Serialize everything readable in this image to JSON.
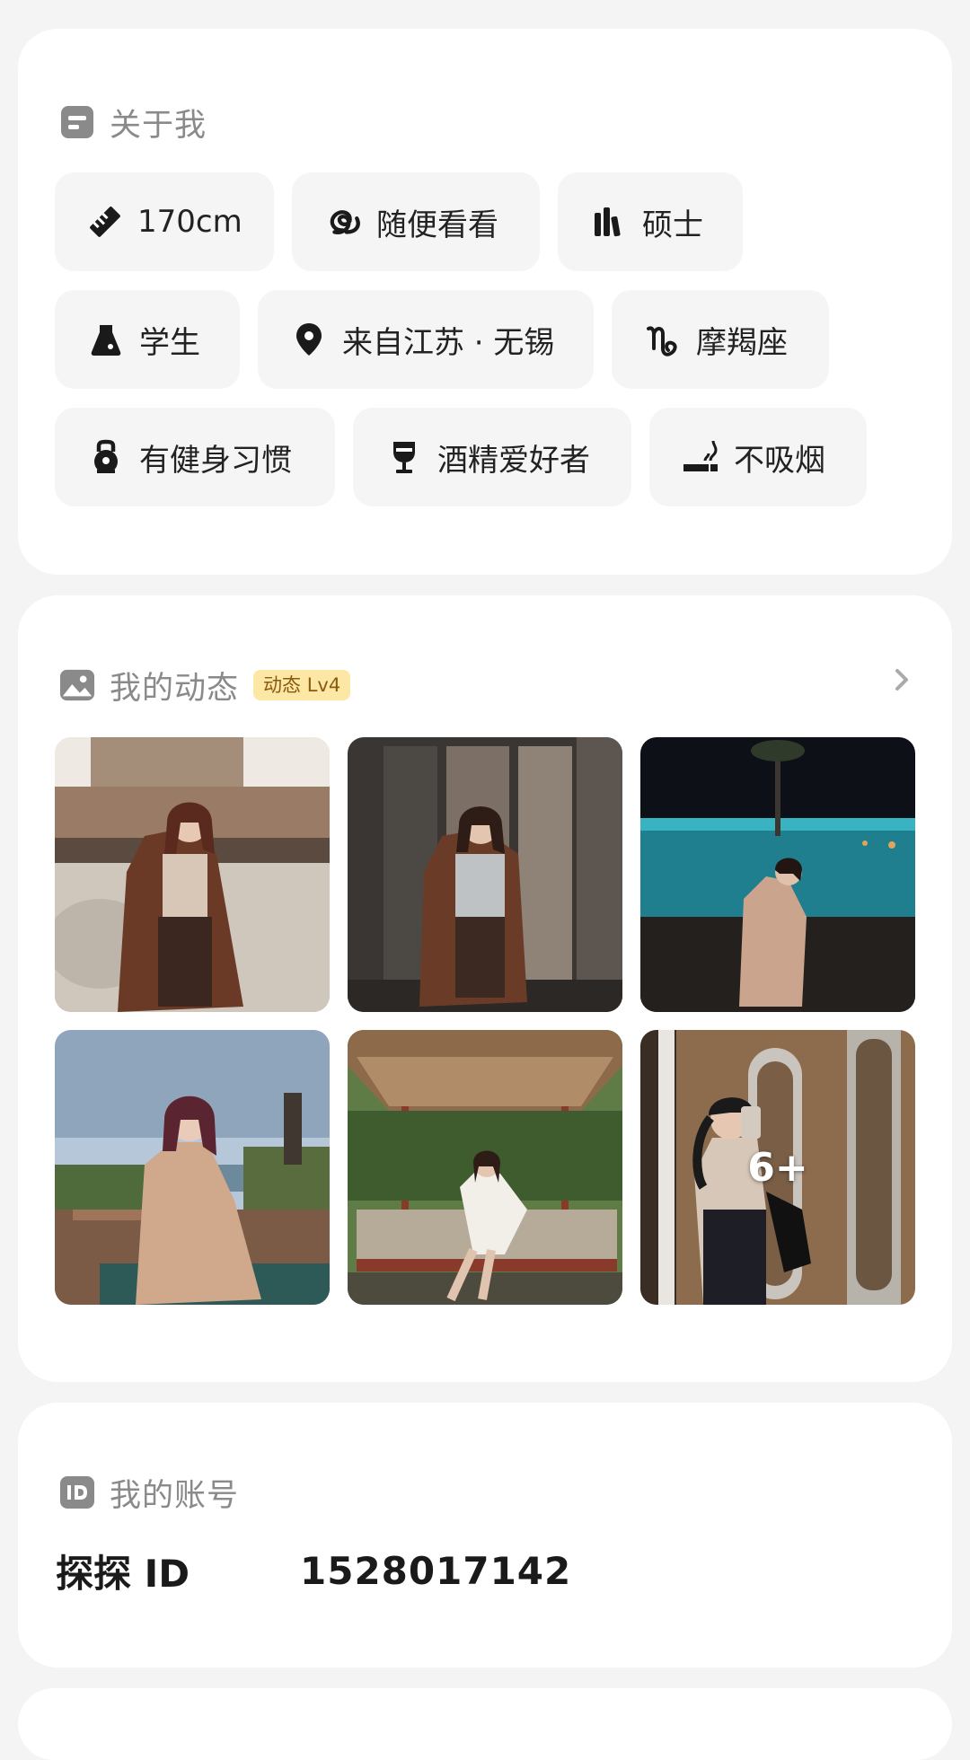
{
  "about": {
    "title": "关于我",
    "tags": [
      {
        "label": "170cm",
        "icon": "ruler-icon"
      },
      {
        "label": "随便看看",
        "icon": "swirl-icon"
      },
      {
        "label": "硕士",
        "icon": "books-icon"
      },
      {
        "label": "学生",
        "icon": "flask-icon"
      },
      {
        "label": "来自江苏 · 无锡",
        "icon": "location-pin-icon"
      },
      {
        "label": "摩羯座",
        "icon": "capricorn-icon"
      },
      {
        "label": "有健身习惯",
        "icon": "kettlebell-icon"
      },
      {
        "label": "酒精爱好者",
        "icon": "wine-glass-icon"
      },
      {
        "label": "不吸烟",
        "icon": "cigarette-icon"
      }
    ]
  },
  "moments": {
    "title": "我的动态",
    "level_badge": "动态 Lv4",
    "more_count": "6+"
  },
  "account": {
    "title": "我的账号",
    "id_label": "探探 ID",
    "id_value": "1528017142"
  },
  "colors": {
    "badge_bg": "#fde7a4",
    "badge_text": "#8a5a10",
    "tag_bg": "#f5f5f5",
    "header_text": "#8a8a8a"
  }
}
